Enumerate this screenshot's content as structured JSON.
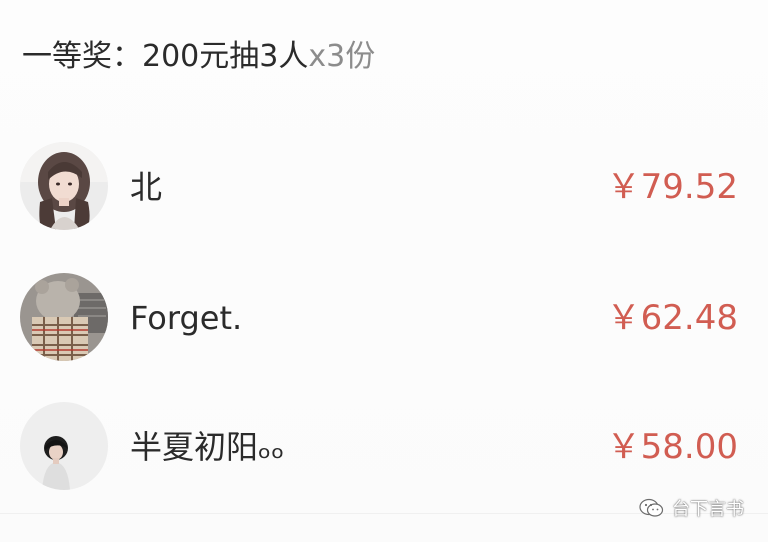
{
  "prize": {
    "title": "一等奖：200元抽3人",
    "count": "x3份"
  },
  "winners": [
    {
      "name": "北",
      "amount": "￥79.52",
      "avatar": "avatar-girl-long-hair"
    },
    {
      "name": "Forget.",
      "amount": "￥62.48",
      "avatar": "avatar-plush-toy"
    },
    {
      "name": "半夏初阳ₒₒ",
      "amount": "￥58.00",
      "avatar": "avatar-boy-black-hair"
    }
  ],
  "watermark": {
    "text": "台下言书",
    "icon": "wechat-official-account-icon"
  },
  "colors": {
    "amount": "#d15d52",
    "text": "#2b2b2b",
    "muted": "#8c8c8c"
  }
}
